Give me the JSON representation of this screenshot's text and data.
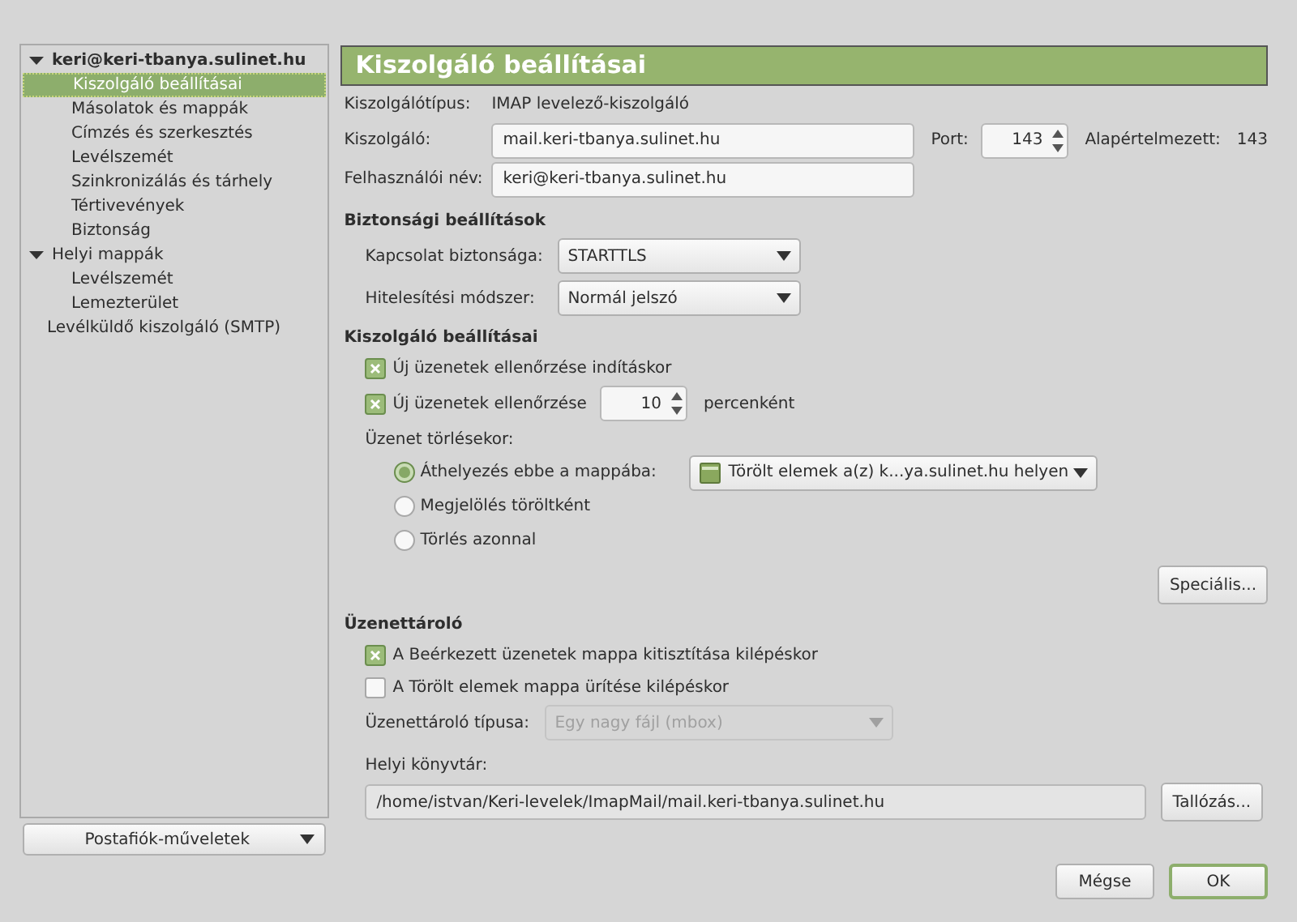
{
  "sidebar": {
    "tree": [
      {
        "label": "keri@keri-tbanya.sulinet.hu",
        "bold": true,
        "expanded": true,
        "selected": false,
        "children": [
          {
            "label": "Kiszolgáló beállításai",
            "selected": true
          },
          {
            "label": "Másolatok és mappák",
            "selected": false
          },
          {
            "label": "Címzés és szerkesztés",
            "selected": false
          },
          {
            "label": "Levélszemét",
            "selected": false
          },
          {
            "label": "Szinkronizálás és tárhely",
            "selected": false
          },
          {
            "label": "Tértivevények",
            "selected": false
          },
          {
            "label": "Biztonság",
            "selected": false
          }
        ]
      },
      {
        "label": "Helyi mappák",
        "bold": false,
        "expanded": true,
        "selected": false,
        "children": [
          {
            "label": "Levélszemét",
            "selected": false
          },
          {
            "label": "Lemezterület",
            "selected": false
          }
        ]
      },
      {
        "label": "Levélküldő kiszolgáló (SMTP)",
        "bold": false,
        "selected": false
      }
    ],
    "account_actions": "Postafiók-műveletek"
  },
  "page_title": "Kiszolgáló beállításai",
  "server_type": {
    "label": "Kiszolgálótípus:",
    "value": "IMAP levelező-kiszolgáló"
  },
  "server": {
    "label": "Kiszolgáló:",
    "value": "mail.keri-tbanya.sulinet.hu",
    "port_label": "Port:",
    "port": "143",
    "default_label": "Alapértelmezett:",
    "default": "143"
  },
  "username": {
    "label": "Felhasználói név:",
    "value": "keri@keri-tbanya.sulinet.hu"
  },
  "security": {
    "heading": "Biztonsági beállítások",
    "rows": [
      {
        "label": "Kapcsolat biztonsága:",
        "value": "STARTTLS"
      },
      {
        "label": "Hitelesítési módszer:",
        "value": "Normál jelszó"
      }
    ]
  },
  "server_settings": {
    "heading": "Kiszolgáló beállításai",
    "check_startup": {
      "label": "Új üzenetek ellenőrzése indításkor",
      "checked": true
    },
    "check_every": {
      "label": "Új üzenetek ellenőrzése",
      "checked": true,
      "minutes": "10",
      "suffix": "percenként"
    },
    "delete_label": "Üzenet törlésekor:",
    "delete_options": [
      {
        "label": "Áthelyezés ebbe a mappába:",
        "selected": true,
        "folder": "Törölt elemek a(z) k...ya.sulinet.hu helyen"
      },
      {
        "label": "Megjelölés töröltként",
        "selected": false
      },
      {
        "label": "Törlés azonnal",
        "selected": false
      }
    ],
    "advanced_button": "Speciális..."
  },
  "storage": {
    "heading": "Üzenettároló",
    "options": [
      {
        "label": "A Beérkezett üzenetek mappa kitisztítása kilépéskor",
        "checked": true
      },
      {
        "label": "A Törölt elemek mappa ürítése kilépéskor",
        "checked": false
      }
    ],
    "type_label": "Üzenettároló típusa:",
    "type_value": "Egy nagy fájl (mbox)",
    "type_disabled": true,
    "dir_label": "Helyi könyvtár:",
    "dir_value": "/home/istvan/Keri-levelek/ImapMail/mail.keri-tbanya.sulinet.hu",
    "browse_button": "Tallózás..."
  },
  "buttons": [
    {
      "label": "Mégse",
      "default": false
    },
    {
      "label": "OK",
      "default": true
    }
  ]
}
